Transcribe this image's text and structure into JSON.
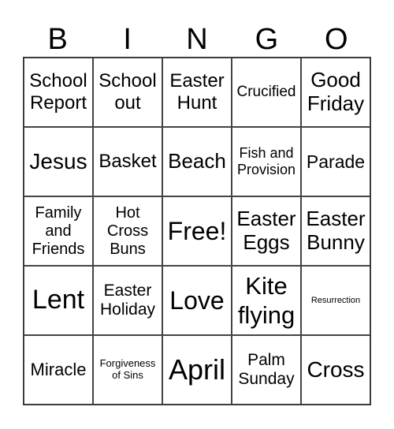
{
  "header": [
    "B",
    "I",
    "N",
    "G",
    "O"
  ],
  "cells": [
    "School Report",
    "School out",
    "Easter Hunt",
    "Crucified",
    "Good Friday",
    "Jesus",
    "Basket",
    "Beach",
    "Fish and Provision",
    "Parade",
    "Family and Friends",
    "Hot Cross Buns",
    "Free!",
    "Easter Eggs",
    "Easter Bunny",
    "Lent",
    "Easter Holiday",
    "Love",
    "Kite flying",
    "Resurrection",
    "Miracle",
    "Forgiveness of Sins",
    "April",
    "Palm Sunday",
    "Cross"
  ]
}
